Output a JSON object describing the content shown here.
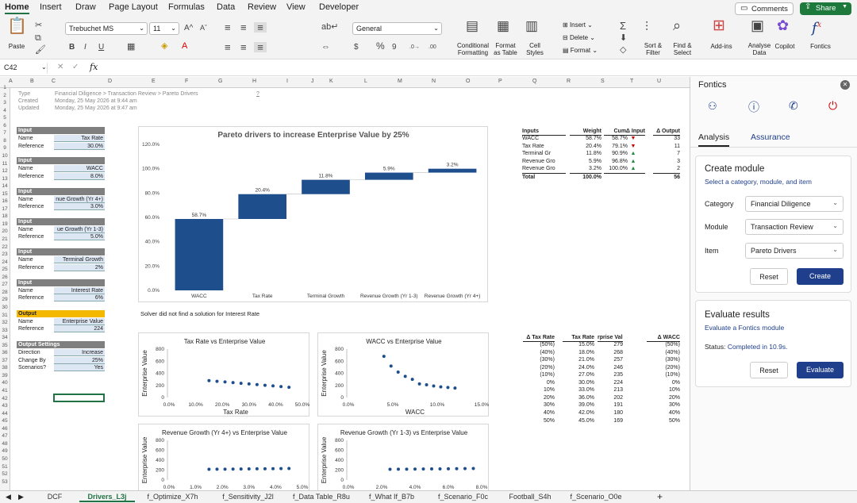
{
  "ribbon": {
    "tabs": [
      "Home",
      "Insert",
      "Draw",
      "Page Layout",
      "Formulas",
      "Data",
      "Review",
      "View",
      "Developer"
    ],
    "comments": "Comments",
    "share": "Share",
    "paste": "Paste",
    "font": "Trebuchet MS",
    "font_size": "11",
    "number_format": "General",
    "bold": "B",
    "italic": "I",
    "underline": "U",
    "conditional": "Conditional\nFormatting",
    "format_table": "Format\nas Table",
    "cell_styles": "Cell\nStyles",
    "insert": "Insert",
    "delete": "Delete",
    "format": "Format",
    "sort": "Sort &\nFilter",
    "find": "Find &\nSelect",
    "addins": "Add-ins",
    "analyse": "Analyse\nData",
    "copilot": "Copilot",
    "fontics": "Fontics"
  },
  "formula_bar": {
    "cell_ref": "C42",
    "fx": "fx",
    "value": ""
  },
  "columns": [
    "A",
    "B",
    "C",
    "D",
    "E",
    "F",
    "G",
    "H",
    "I",
    "J",
    "K",
    "L",
    "M",
    "N",
    "O",
    "P",
    "Q",
    "R",
    "S",
    "T",
    "U"
  ],
  "header_info": {
    "type_label": "Type",
    "type_value": "Financial Diligence > Transaction Review > Pareto Drivers",
    "q": "?",
    "created_label": "Created",
    "created_value": "Monday, 25 May 2026 at 9:44 am",
    "updated_label": "Updated",
    "updated_value": "Monday, 25 May 2026 at 9:47 am"
  },
  "input_blocks": [
    {
      "title": "Input",
      "name": "Tax Rate",
      "ref": "30.0%"
    },
    {
      "title": "Input",
      "name": "WACC",
      "ref": "8.0%"
    },
    {
      "title": "Input",
      "name": "nue Growth (Yr 4+)",
      "ref": "3.0%"
    },
    {
      "title": "Input",
      "name": "ue Growth (Yr 1-3)",
      "ref": "5.0%"
    },
    {
      "title": "Input",
      "name": "Terminal Growth",
      "ref": "2%"
    },
    {
      "title": "Input",
      "name": "Interest Rate",
      "ref": "6%"
    }
  ],
  "labels": {
    "name": "Name",
    "reference": "Reference"
  },
  "output_block": {
    "title": "Output",
    "name": "Enterprise Value",
    "ref": "224"
  },
  "output_settings": {
    "title": "Output Settings",
    "rows": [
      [
        "Direction",
        "Increase"
      ],
      [
        "Change By",
        "25%"
      ],
      [
        "Scenarios?",
        "Yes"
      ]
    ]
  },
  "solver_msg": "Solver did not find a solution for Interest Rate",
  "pareto_table": {
    "headers": [
      "Inputs",
      "Weight",
      "Cum.",
      "Δ Input",
      "Δ Output"
    ],
    "rows": [
      [
        "WACC",
        "58.7%",
        "58.7%",
        "▼",
        "33"
      ],
      [
        "Tax Rate",
        "20.4%",
        "79.1%",
        "▼",
        "11"
      ],
      [
        "Terminal Gr",
        "11.8%",
        "90.9%",
        "▲",
        "7"
      ],
      [
        "Revenue Gro",
        "5.9%",
        "96.8%",
        "▲",
        "3"
      ],
      [
        "Revenue Gro",
        "3.2%",
        "100.0%",
        "▲",
        "2"
      ]
    ],
    "total": [
      "Total",
      "100.0%",
      "",
      "",
      "56"
    ]
  },
  "sens_table": {
    "headers": [
      "Δ Tax Rate",
      "Tax Rate",
      "rprise Value",
      "Δ WACC"
    ],
    "rows": [
      [
        "(50%)",
        "15.0%",
        "279",
        "(50%)"
      ],
      [
        "(40%)",
        "18.0%",
        "268",
        "(40%)"
      ],
      [
        "(30%)",
        "21.0%",
        "257",
        "(30%)"
      ],
      [
        "(20%)",
        "24.0%",
        "246",
        "(20%)"
      ],
      [
        "(10%)",
        "27.0%",
        "235",
        "(10%)"
      ],
      [
        "0%",
        "30.0%",
        "224",
        "0%"
      ],
      [
        "10%",
        "33.0%",
        "213",
        "10%"
      ],
      [
        "20%",
        "36.0%",
        "202",
        "20%"
      ],
      [
        "30%",
        "39.0%",
        "191",
        "30%"
      ],
      [
        "40%",
        "42.0%",
        "180",
        "40%"
      ],
      [
        "50%",
        "45.0%",
        "169",
        "50%"
      ]
    ]
  },
  "chart_data": [
    {
      "type": "bar",
      "title": "Pareto drivers to increase Enterprise Value by 25%",
      "categories": [
        "WACC",
        "Tax Rate",
        "Terminal Growth",
        "Revenue Growth (Yr 1-3)",
        "Revenue Growth (Yr 4+)"
      ],
      "values": [
        58.7,
        20.4,
        11.8,
        5.9,
        3.2
      ],
      "data_labels": [
        "58.7%",
        "20.4%",
        "11.8%",
        "5.9%",
        "3.2%"
      ],
      "yticks": [
        "0.0%",
        "20.0%",
        "40.0%",
        "60.0%",
        "80.0%",
        "100.0%",
        "120.0%"
      ],
      "ylim": [
        0,
        120
      ],
      "color": "#1f4e8c"
    },
    {
      "type": "scatter",
      "title": "Tax Rate vs Enterprise Value",
      "xlabel": "Tax Rate",
      "ylabel": "Enterprise Value",
      "xticks": [
        "0.0%",
        "10.0%",
        "20.0%",
        "30.0%",
        "40.0%",
        "50.0%"
      ],
      "yticks": [
        "0",
        "200",
        "400",
        "600",
        "800"
      ],
      "xlim": [
        0,
        50
      ],
      "ylim": [
        0,
        800
      ],
      "x": [
        15,
        18,
        21,
        24,
        27,
        30,
        33,
        36,
        39,
        42,
        45
      ],
      "y": [
        279,
        268,
        257,
        246,
        235,
        224,
        213,
        202,
        191,
        180,
        169
      ]
    },
    {
      "type": "scatter",
      "title": "WACC vs Enterprise Value",
      "xlabel": "WACC",
      "ylabel": "Enterprise Value",
      "xticks": [
        "0.0%",
        "5.0%",
        "10.0%",
        "15.0%"
      ],
      "yticks": [
        "0",
        "200",
        "400",
        "600",
        "800"
      ],
      "xlim": [
        0,
        15
      ],
      "ylim": [
        0,
        800
      ],
      "x": [
        4,
        4.8,
        5.6,
        6.4,
        7.2,
        8,
        8.8,
        9.6,
        10.4,
        11.2,
        12
      ],
      "y": [
        680,
        520,
        420,
        350,
        300,
        224,
        210,
        190,
        175,
        165,
        155
      ]
    },
    {
      "type": "scatter",
      "title": "Revenue Growth (Yr 4+) vs Enterprise Value",
      "xlabel": "",
      "ylabel": "Enterprise Value",
      "xticks": [
        "0.0%",
        "1.0%",
        "2.0%",
        "3.0%",
        "4.0%",
        "5.0%"
      ],
      "yticks": [
        "0",
        "200",
        "400",
        "600",
        "800"
      ],
      "xlim": [
        0,
        5
      ],
      "ylim": [
        0,
        800
      ],
      "x": [
        1.5,
        1.8,
        2.1,
        2.4,
        2.7,
        3.0,
        3.3,
        3.6,
        3.9,
        4.2,
        4.5
      ],
      "y": [
        217,
        218,
        219,
        221,
        222,
        224,
        226,
        227,
        229,
        231,
        233
      ]
    },
    {
      "type": "scatter",
      "title": "Revenue Growth (Yr 1-3) vs Enterprise Value",
      "xlabel": "",
      "ylabel": "Enterprise Value",
      "xticks": [
        "0.0%",
        "2.0%",
        "4.0%",
        "6.0%",
        "8.0%"
      ],
      "yticks": [
        "0",
        "200",
        "400",
        "600",
        "800"
      ],
      "xlim": [
        0,
        8
      ],
      "ylim": [
        0,
        800
      ],
      "x": [
        2.5,
        3.0,
        3.5,
        4.0,
        4.5,
        5.0,
        5.5,
        6.0,
        6.5,
        7.0,
        7.5
      ],
      "y": [
        216,
        218,
        219,
        221,
        222,
        224,
        225,
        227,
        229,
        231,
        232
      ]
    }
  ],
  "panel": {
    "title": "Fontics",
    "tabs": [
      "Analysis",
      "Assurance"
    ],
    "create_title": "Create module",
    "create_sub": "Select a category, module, and item",
    "category_label": "Category",
    "category_value": "Financial Diligence",
    "module_label": "Module",
    "module_value": "Transaction Review",
    "item_label": "Item",
    "item_value": "Pareto Drivers",
    "reset": "Reset",
    "create": "Create",
    "eval_title": "Evaluate results",
    "eval_sub": "Evaluate a Fontics module",
    "status_label": "Status:",
    "status_value": "Completed in 10.9s.",
    "evaluate": "Evaluate",
    "accent": "#1f3f8c"
  },
  "sheet_tabs": [
    "DCF",
    "Drivers_L3j",
    "f_Optimize_X7h",
    "f_Sensitivity_J2l",
    "f_Data Table_R8u",
    "f_What If_B7b",
    "f_Scenario_F0c",
    "Football_S4h",
    "f_Scenario_O0e"
  ],
  "active_sheet": "Drivers_L3j"
}
